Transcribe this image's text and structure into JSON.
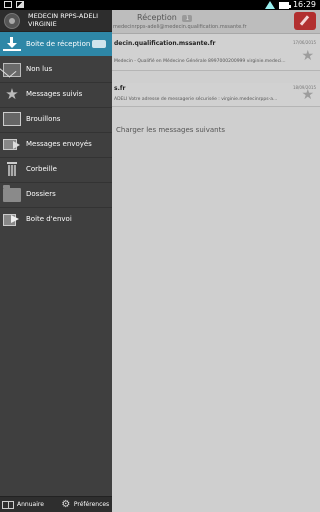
{
  "status_bar": {
    "time": "16:29"
  },
  "main": {
    "title": "Réception",
    "unread_count": "1",
    "account_address": "medecinrpps-adeli@medecin.qualification.mssante.fr",
    "messages": [
      {
        "from": "decin.qualification.mssante.fr",
        "date": "17/06/2015",
        "preview": "Medecin - Qualifié en Médecine Générale 8997000200999 virginie.medeci..."
      },
      {
        "from": "s.fr",
        "date": "18/09/2015",
        "preview": "ADELI Votre adresse de messagerie sécurisée : virginie.medecinrpps-a..."
      }
    ],
    "load_more": "Charger les messages suivants"
  },
  "drawer": {
    "account_name": "MEDECIN RPPS-ADELI VIRGINIE",
    "items": [
      {
        "label": "Boite de réception",
        "icon": "download-icon",
        "active": true
      },
      {
        "label": "Non lus",
        "icon": "envelope-icon"
      },
      {
        "label": "Messages suivis",
        "icon": "star-icon"
      },
      {
        "label": "Brouillons",
        "icon": "draft-icon"
      },
      {
        "label": "Messages envoyés",
        "icon": "send-icon"
      },
      {
        "label": "Corbeille",
        "icon": "trash-icon"
      },
      {
        "label": "Dossiers",
        "icon": "folder-icon"
      },
      {
        "label": "Boite d'envoi",
        "icon": "outbox-icon"
      }
    ],
    "footer": {
      "directory_label": "Annuaire",
      "preferences_label": "Préférences"
    }
  },
  "colors": {
    "accent": "#2e87a7",
    "drawer_bg": "#3f3f3f",
    "compose": "#b23030"
  }
}
